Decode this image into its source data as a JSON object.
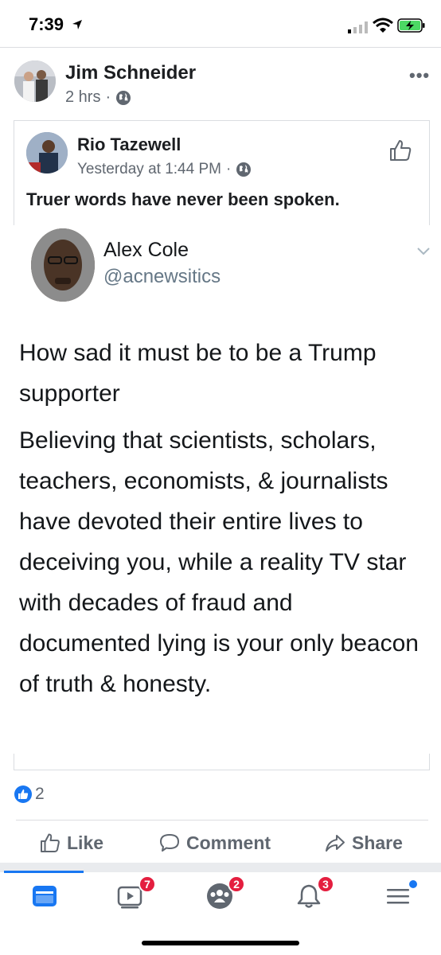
{
  "status_bar": {
    "time": "7:39"
  },
  "post": {
    "author": "Jim Schneider",
    "time": "2 hrs",
    "separator": "·"
  },
  "shared": {
    "author": "Rio Tazewell",
    "time": "Yesterday at 1:44 PM",
    "separator": "·",
    "text": "Truer words have never been spoken."
  },
  "tweet": {
    "name": "Alex Cole",
    "handle": "@acnewsitics",
    "paragraph1": "How sad it must be to be a Trump supporter",
    "paragraph2": "Believing that scientists, scholars, teachers, economists, & journalists have devoted their entire lives to deceiving you, while a reality TV star with decades of fraud and  documented lying is your only beacon of truth & honesty."
  },
  "reactions": {
    "count": "2"
  },
  "actions": {
    "like": "Like",
    "comment": "Comment",
    "share": "Share"
  },
  "tab_bar": {
    "video_badge": "7",
    "groups_badge": "2",
    "notifications_badge": "3"
  },
  "colors": {
    "accent": "#1877f2",
    "badge": "#e41e3f",
    "secondary_text": "#606770"
  }
}
